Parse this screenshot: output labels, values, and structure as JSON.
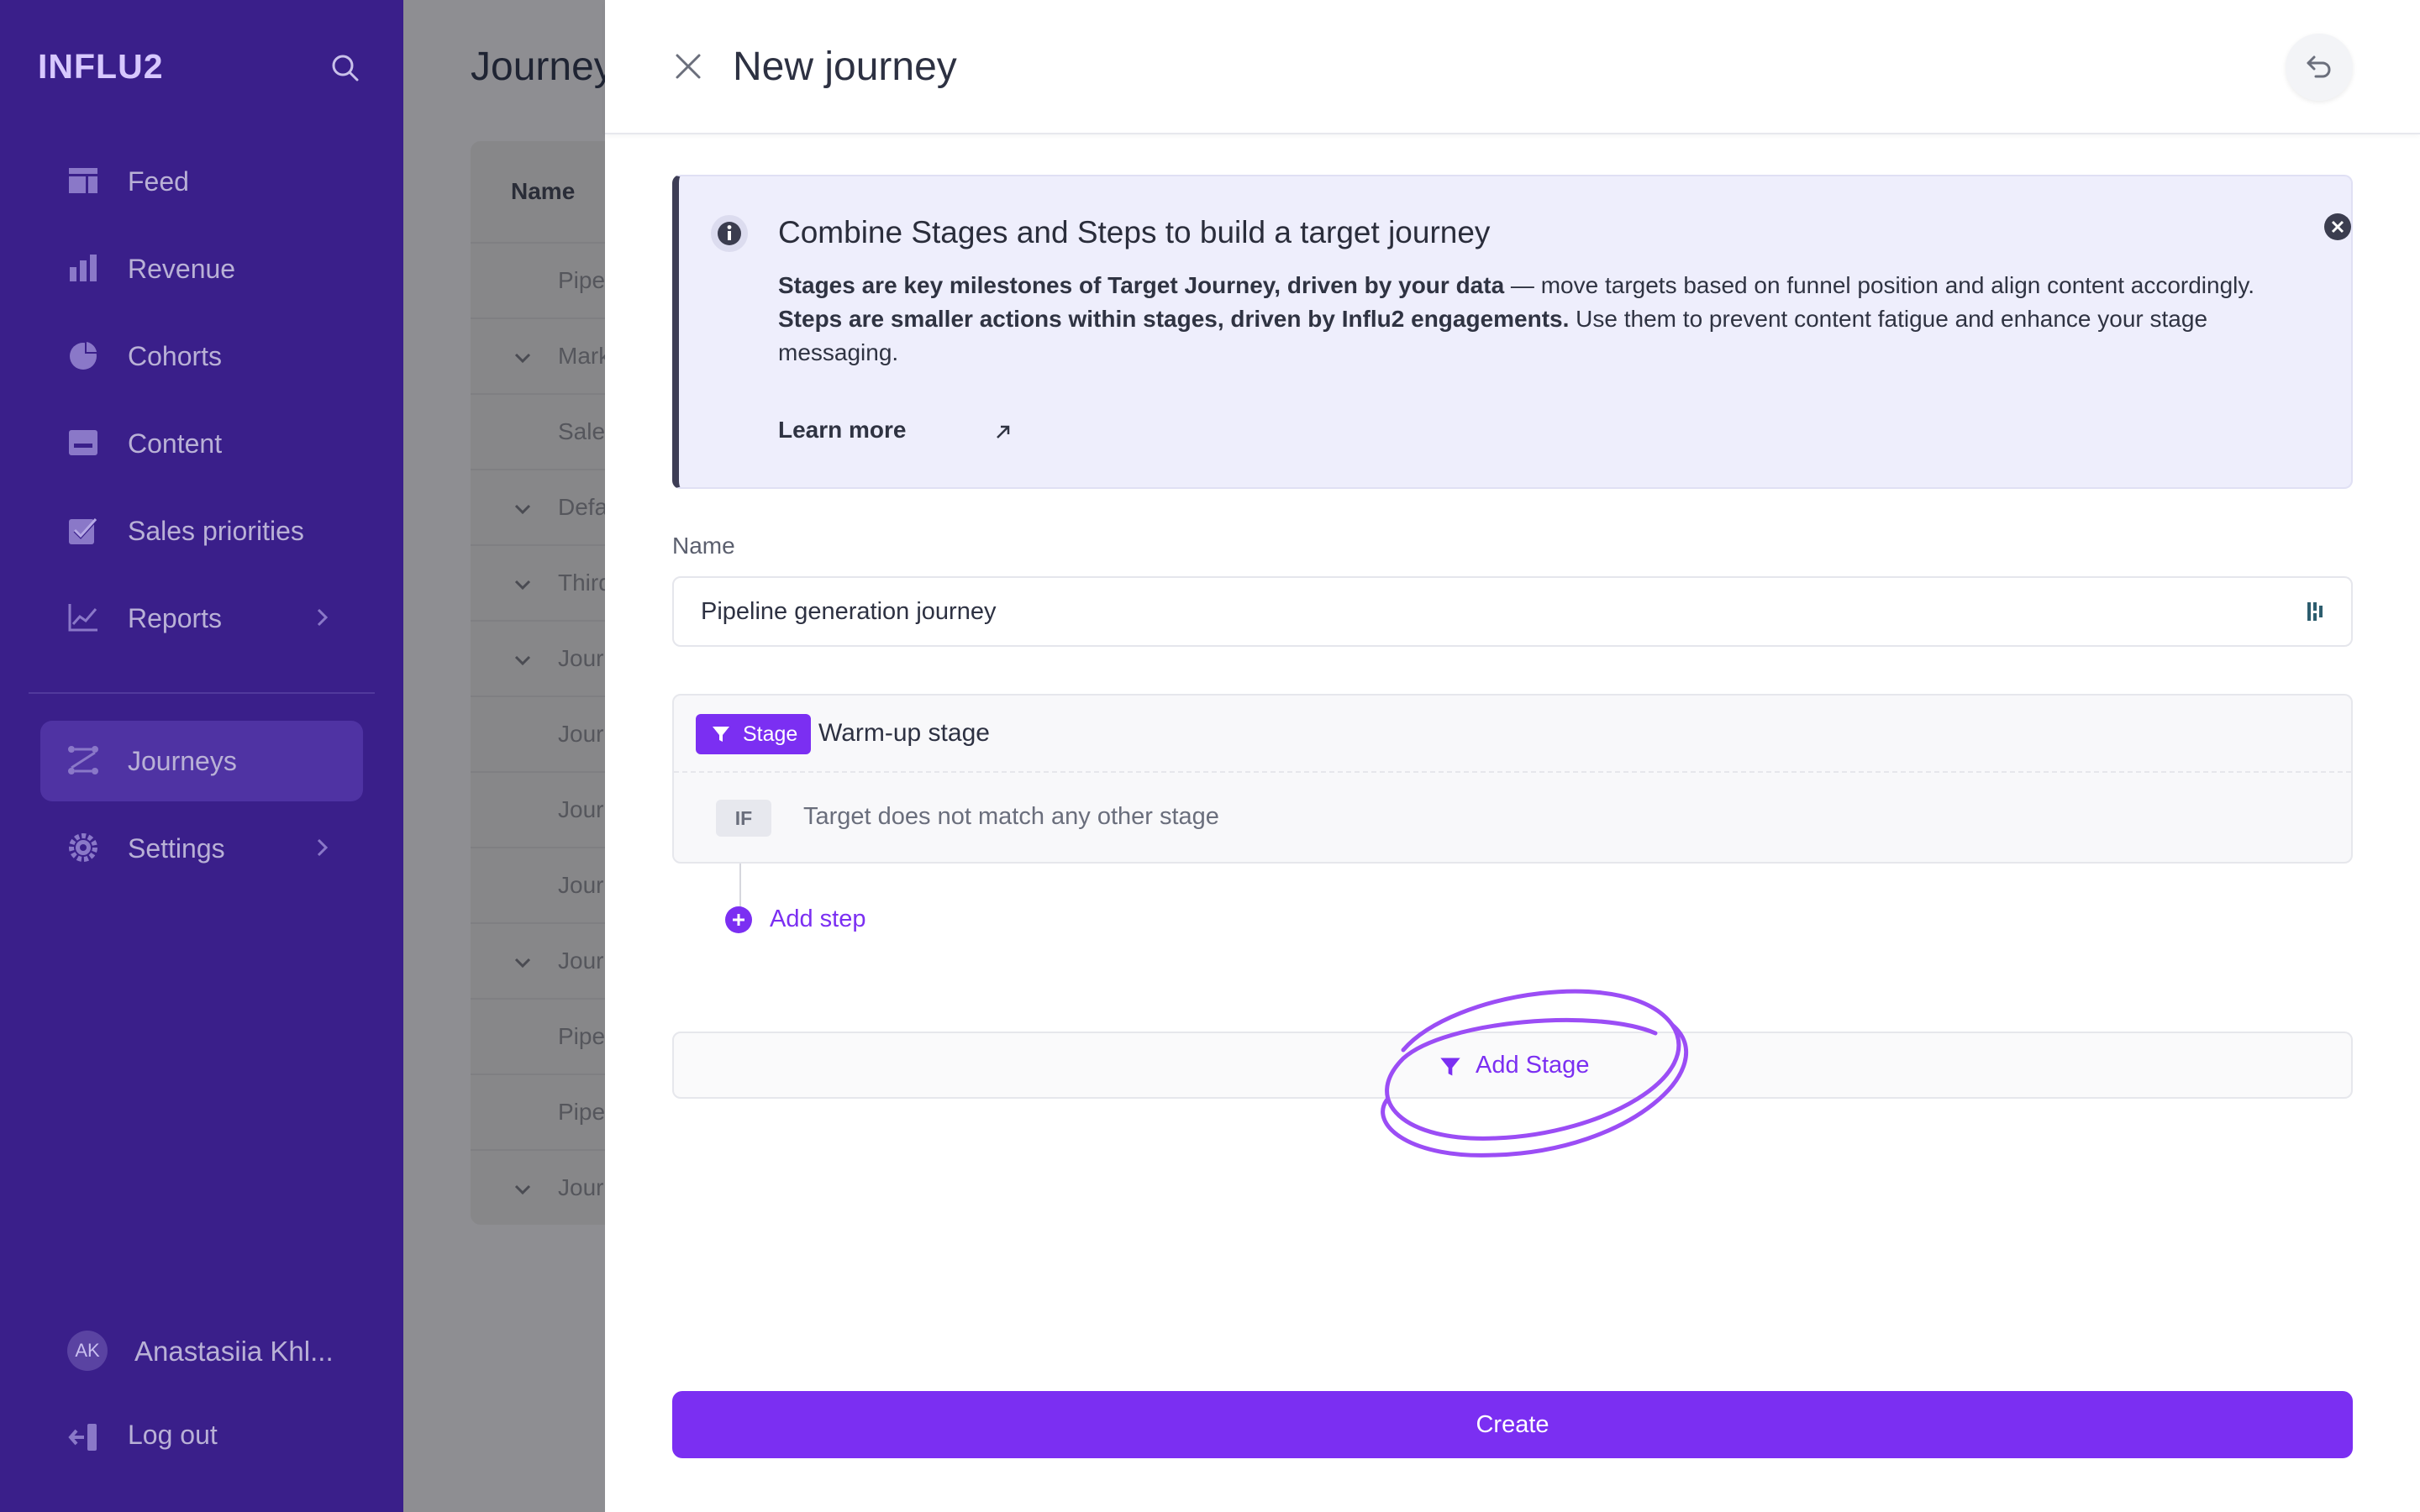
{
  "app": {
    "logo": "INFLU2"
  },
  "sidebar": {
    "items": [
      {
        "label": "Feed",
        "icon": "feed-icon"
      },
      {
        "label": "Revenue",
        "icon": "bar-chart-icon"
      },
      {
        "label": "Cohorts",
        "icon": "pie-chart-icon"
      },
      {
        "label": "Content",
        "icon": "content-icon"
      },
      {
        "label": "Sales priorities",
        "icon": "checkbox-icon"
      },
      {
        "label": "Reports",
        "icon": "line-chart-icon"
      },
      {
        "label": "Journeys",
        "icon": "journeys-icon",
        "active": true
      },
      {
        "label": "Settings",
        "icon": "gear-icon"
      }
    ],
    "user": {
      "initials": "AK",
      "name": "Anastasiia Khl..."
    },
    "logout_label": "Log out"
  },
  "background_page": {
    "title": "Journeys",
    "column_header": "Name",
    "rows": [
      "Pipeline",
      "Marketing",
      "Sales",
      "Default",
      "Third",
      "Journey",
      "Journey",
      "Journey",
      "Journey",
      "Journey",
      "Pipeline",
      "Pipeline",
      "Journey"
    ]
  },
  "drawer": {
    "title": "New journey",
    "info": {
      "title": "Combine Stages and Steps to build a target journey",
      "line1_bold": "Stages are key milestones of Target Journey, driven by your data",
      "line1_rest": " — move targets based on funnel position and align content accordingly.",
      "line2_bold": "Steps are smaller actions within stages, driven by Influ2 engagements.",
      "line2_rest": " Use them to prevent content fatigue and enhance your stage messaging.",
      "learn_more": "Learn more"
    },
    "name_label": "Name",
    "name_value": "Pipeline generation journey",
    "stage": {
      "badge": "Stage",
      "name": "Warm-up stage",
      "condition_badge": "IF",
      "condition_text": "Target does not match any other stage"
    },
    "add_step_label": "Add step",
    "add_stage_label": "Add Stage",
    "create_label": "Create"
  },
  "colors": {
    "sidebar_bg": "#3a1f8a",
    "accent": "#7b2ff2",
    "info_bg": "#eeeefc"
  }
}
